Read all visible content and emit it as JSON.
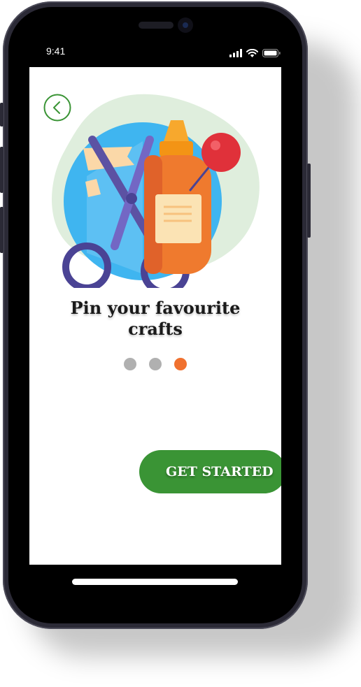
{
  "status_bar": {
    "time": "9:41",
    "icons": [
      "signal-icon",
      "wifi-icon",
      "battery-icon"
    ]
  },
  "onboarding": {
    "back_icon": "chevron-left-icon",
    "illustration": "craft-supplies-illustration",
    "title_line1": "Pin your favourite",
    "title_line2": "crafts",
    "pages_total": 3,
    "active_page": 3,
    "cta_label": "GET STARTED"
  },
  "colors": {
    "primary_green": "#3a9435",
    "accent_orange": "#f0712f",
    "dot_inactive": "#b0b0b0"
  }
}
